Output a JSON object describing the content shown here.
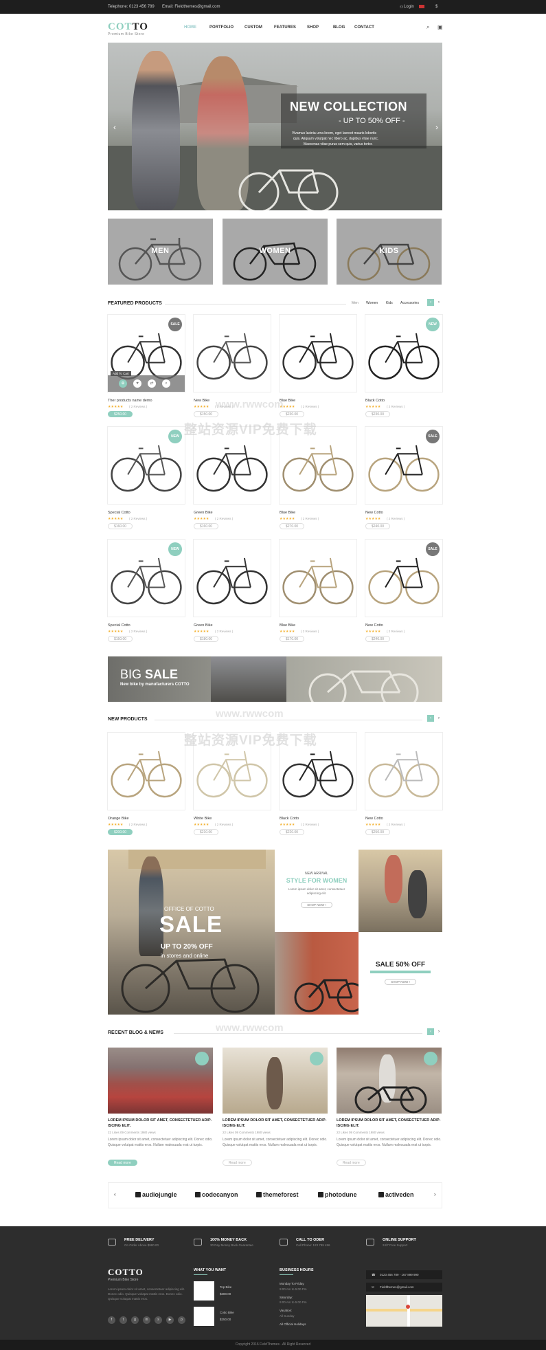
{
  "topbar": {
    "telephone": "Telephone: 0123 456 789",
    "email": "Email: Fieldthemes@gmail.com",
    "login": "Login",
    "currency": "$"
  },
  "logo": {
    "part1": "COT",
    "part2": "TO",
    "sub": "Premium Bike Store"
  },
  "nav": [
    {
      "label": "HOME"
    },
    {
      "label": "PORTFOLIO"
    },
    {
      "label": "CUSTOM"
    },
    {
      "label": "FEATURES"
    },
    {
      "label": "SHOP"
    },
    {
      "label": "BLOG"
    },
    {
      "label": "CONTACT"
    }
  ],
  "hero": {
    "heading": "NEW COLLECTION",
    "subheading": "- UP TO 50% OFF -",
    "text1": "Vivamus lacinia urna lorem, eget laoreet mauris lobortis",
    "text2": "quis. Aliquam volutpat nec libero ac, dapibus vitae nunc.",
    "text3": "Maecenas vitae purus sem quis, varius tortor."
  },
  "categories": [
    "MEN",
    "WOMEN",
    "KIDS"
  ],
  "featured": {
    "title": "FEATURED PRODUCTS",
    "tabs": [
      "Men",
      "Women",
      "Kids",
      "Accessories"
    ],
    "action_labels": [
      "Add To Cart"
    ],
    "products": [
      {
        "name": "Ther products name demo",
        "price": "$250.00",
        "badge": "SALE",
        "revs": "( 2 Reviews )"
      },
      {
        "name": "New Bike",
        "price": "$150.00",
        "badge": "",
        "revs": "( 2 Reviews )"
      },
      {
        "name": "Blue Bike",
        "price": "$230.00",
        "badge": "",
        "revs": "( 2 Reviews )"
      },
      {
        "name": "Black Cotto",
        "price": "$230.00",
        "badge": "NEW",
        "revs": "( 2 Reviews )"
      },
      {
        "name": "Special Cotto",
        "price": "$160.00",
        "badge": "NEW",
        "revs": "( 2 Reviews )"
      },
      {
        "name": "Green Bike",
        "price": "$160.00",
        "badge": "",
        "revs": "( 2 Reviews )"
      },
      {
        "name": "Blue Bike",
        "price": "$270.00",
        "badge": "",
        "revs": "( 2 Reviews )"
      },
      {
        "name": "New Cotto",
        "price": "$240.00",
        "badge": "SALE",
        "revs": "( 2 Reviews )"
      },
      {
        "name": "Special Cotto",
        "price": "$150.00",
        "badge": "NEW",
        "revs": "( 2 Reviews )"
      },
      {
        "name": "Green Bike",
        "price": "$180.00",
        "badge": "",
        "revs": "( 2 Reviews )"
      },
      {
        "name": "Blue Bike",
        "price": "$170.00",
        "badge": "",
        "revs": "( 2 Reviews )"
      },
      {
        "name": "New Cotto",
        "price": "$240.00",
        "badge": "SALE",
        "revs": "( 2 Reviews )"
      }
    ]
  },
  "bigsale": {
    "big": "BIG",
    "sale": "SALE",
    "sub": "New bike by manufacturers COTTO"
  },
  "newproducts": {
    "title": "NEW PRODUCTS",
    "products": [
      {
        "name": "Orange Bike",
        "price": "$200.00",
        "revs": "( 2 Reviews )"
      },
      {
        "name": "White Bike",
        "price": "$210.00",
        "revs": "( 2 Reviews )"
      },
      {
        "name": "Black Cotto",
        "price": "$220.00",
        "revs": "( 2 Reviews )"
      },
      {
        "name": "New Cotto",
        "price": "$250.00",
        "revs": "( 2 Reviews )"
      }
    ]
  },
  "promos": {
    "office": "OFFICE OF COTTO",
    "sale": "SALE",
    "upto": "UP TO 20% OFF",
    "stores": "in stores and online",
    "new_arrival": "NEW ARRIVAL",
    "style_women": "STYLE FOR WOMEN",
    "style_text": "Lorem ipsum dolor sit amet, consectetuer adipiscing elit.",
    "shop_now": "SHOP NOW !",
    "sale50": "SALE 50% OFF",
    "shop_now2": "SHOP NOW !"
  },
  "blog": {
    "title": "RECENT BLOG & NEWS",
    "posts": [
      {
        "title": "LOREM IPSUM DOLOR SIT AMET, CONSECTETUER ADIP-ISCING ELIT.",
        "meta": "22 Likes    09 Comments    1980 views",
        "excerpt": "Lorem ipsum dolor sit amet, consectetuer adipiscing elit. Donec odio. Quisque volutpat mattis eros. Nullam malesuada erat ut turpis.",
        "read": "Read more"
      },
      {
        "title": "LOREM IPSUM DOLOR SIT AMET, CONSECTETUER ADIP-ISCING ELIT.",
        "meta": "22 Likes    09 Comments    1980 views",
        "excerpt": "Lorem ipsum dolor sit amet, consectetuer adipiscing elit. Donec odio. Quisque volutpat mattis eros. Nullam malesuada erat ut turpis.",
        "read": "Read more"
      },
      {
        "title": "LOREM IPSUM DOLOR SIT AMET, CONSECTETUER ADIP-ISCING ELIT.",
        "meta": "22 Likes    09 Comments    1980 views",
        "excerpt": "Lorem ipsum dolor sit amet, consectetuer adipiscing elit. Donec odio. Quisque volutpat mattis eros. Nullam malesuada erat ut turpis.",
        "read": "Read more"
      }
    ]
  },
  "brands": [
    "audiojungle",
    "codecanyon",
    "themeforest",
    "photodune",
    "activeden"
  ],
  "services": [
    {
      "title": "FREE DELIVERY",
      "sub": "On Order Above $980.00"
    },
    {
      "title": "100% MONEY BACK",
      "sub": "30 Day Money Back Guarantee"
    },
    {
      "title": "CALL TO ODER",
      "sub": "Call Phone: 123 789 456"
    },
    {
      "title": "ONLINE SUPPORT",
      "sub": "24/7 Free Support"
    }
  ],
  "footer": {
    "logo": "COTTO",
    "logo_sub": "Premium Bike Store",
    "about": "Lorem ipsum dolor sit amet, consectetuer adipiscing elit. Donec odio. Quisque volutpat mattis eros. Donec odio. Quisque volutpat mattis eros.",
    "want_title": "WHAT YOU WANT",
    "want_items": [
      {
        "name": "Top Bike",
        "price": "$280.00"
      },
      {
        "name": "Cotto Bike",
        "price": "$250.00"
      }
    ],
    "hours_title": "BUSINESS HOURS",
    "hours": [
      "Monday To Friday",
      "9:00 Am to 5:00 Pm",
      "Saturday:",
      "9:00 Am to 5:00 Pm",
      "Vacation:",
      "All Sunday",
      "All Official Holidays"
    ],
    "phone": "0123 456 789 - 167 899 990",
    "email": "Fieldthemes@gmail.com",
    "copyright": "Copyright 2016 FieldThemes . All Right Reserved"
  },
  "watermark": {
    "url": "www.rwwcom",
    "cn": "整站资源VIP免费下载"
  }
}
